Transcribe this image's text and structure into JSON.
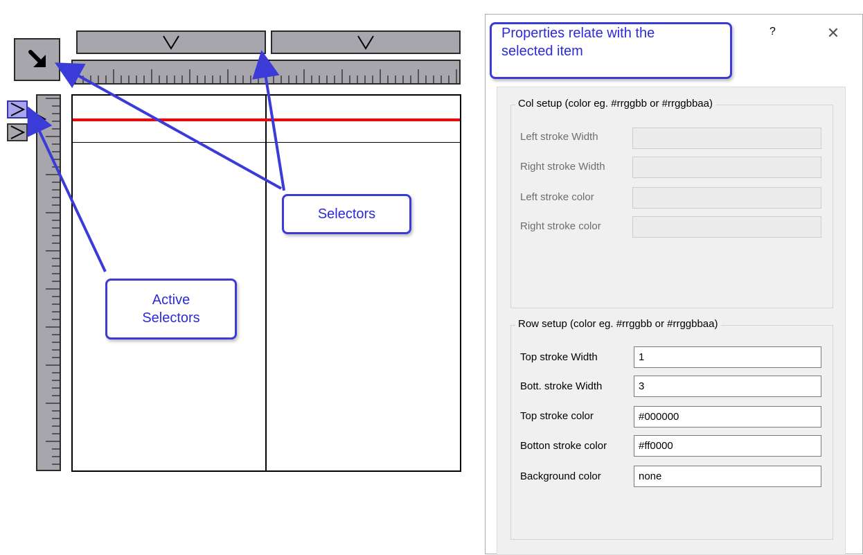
{
  "canvas": {
    "corner_button_icon": "arrow-down-right-icon",
    "column_selectors": [
      {
        "icon": "chevron-down-icon",
        "glyph": "V"
      },
      {
        "icon": "chevron-down-icon",
        "glyph": "V"
      }
    ],
    "row_selectors": [
      {
        "icon": "chevron-right-icon",
        "active": true
      },
      {
        "icon": "chevron-right-icon",
        "active": false
      }
    ],
    "row_bottom_stroke_color": "#ff0000",
    "row_top_stroke_color": "#000000"
  },
  "callouts": {
    "properties": "Properties relate with the selected item",
    "properties_line1": "Properties relate with the",
    "properties_line2": "selected item",
    "selectors": "Selectors",
    "active_selectors_line1": "Active",
    "active_selectors_line2": "Selectors",
    "color": "#3b3bd7"
  },
  "dialog": {
    "help_glyph": "?",
    "close_glyph": "✕",
    "col_setup": {
      "legend": "Col setup (color eg. #rrggbb or #rrggbbaa)",
      "fields": [
        {
          "label": "Left stroke Width",
          "value": ""
        },
        {
          "label": "Right stroke Width",
          "value": ""
        },
        {
          "label": "Left stroke color",
          "value": ""
        },
        {
          "label": "Right stroke color",
          "value": ""
        }
      ]
    },
    "row_setup": {
      "legend": "Row setup (color eg. #rrggbb or #rrggbbaa)",
      "fields": [
        {
          "label": "Top stroke Width",
          "value": "1"
        },
        {
          "label": "Bott. stroke Width",
          "value": "3"
        },
        {
          "label": "Top stroke color",
          "value": "#000000"
        },
        {
          "label": "Botton stroke color",
          "value": "#ff0000"
        },
        {
          "label": "Background color",
          "value": "none"
        }
      ]
    }
  }
}
